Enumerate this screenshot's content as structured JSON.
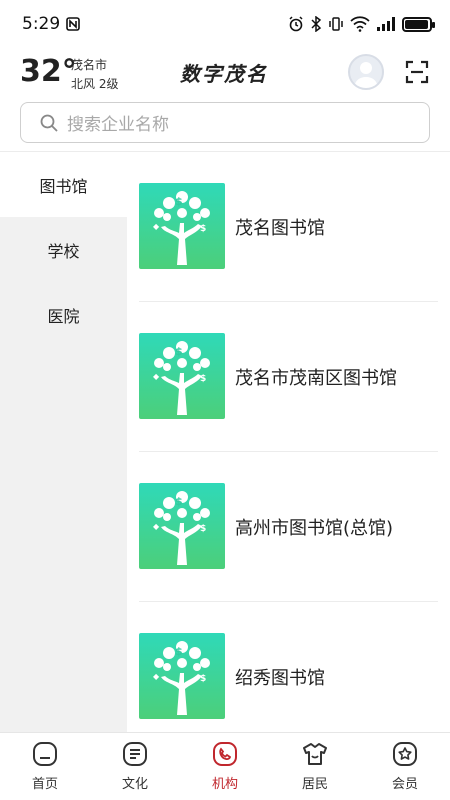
{
  "status_bar": {
    "time": "5:29",
    "battery_level": 0.95
  },
  "header": {
    "temperature": "32°",
    "city": "茂名市",
    "wind": "北风  2级",
    "app_title": "数字茂名"
  },
  "search": {
    "placeholder": "搜索企业名称"
  },
  "sidebar": {
    "items": [
      {
        "label": "图书馆",
        "active": true
      },
      {
        "label": "学校",
        "active": false
      },
      {
        "label": "医院",
        "active": false
      }
    ]
  },
  "list": {
    "items": [
      {
        "name": "茂名图书馆"
      },
      {
        "name": "茂名市茂南区图书馆"
      },
      {
        "name": "高州市图书馆(总馆)"
      },
      {
        "name": "绍秀图书馆"
      }
    ]
  },
  "bottom_nav": {
    "items": [
      {
        "label": "首页",
        "icon": "home-icon"
      },
      {
        "label": "文化",
        "icon": "culture-icon"
      },
      {
        "label": "机构",
        "icon": "institution-icon",
        "active": true
      },
      {
        "label": "居民",
        "icon": "resident-icon"
      },
      {
        "label": "会员",
        "icon": "member-icon"
      }
    ]
  },
  "colors": {
    "accent": "#c0272d",
    "thumb_top": "#2fd9b8",
    "thumb_bottom": "#4ccf7a",
    "sidebar_bg": "#f1f1f1"
  }
}
